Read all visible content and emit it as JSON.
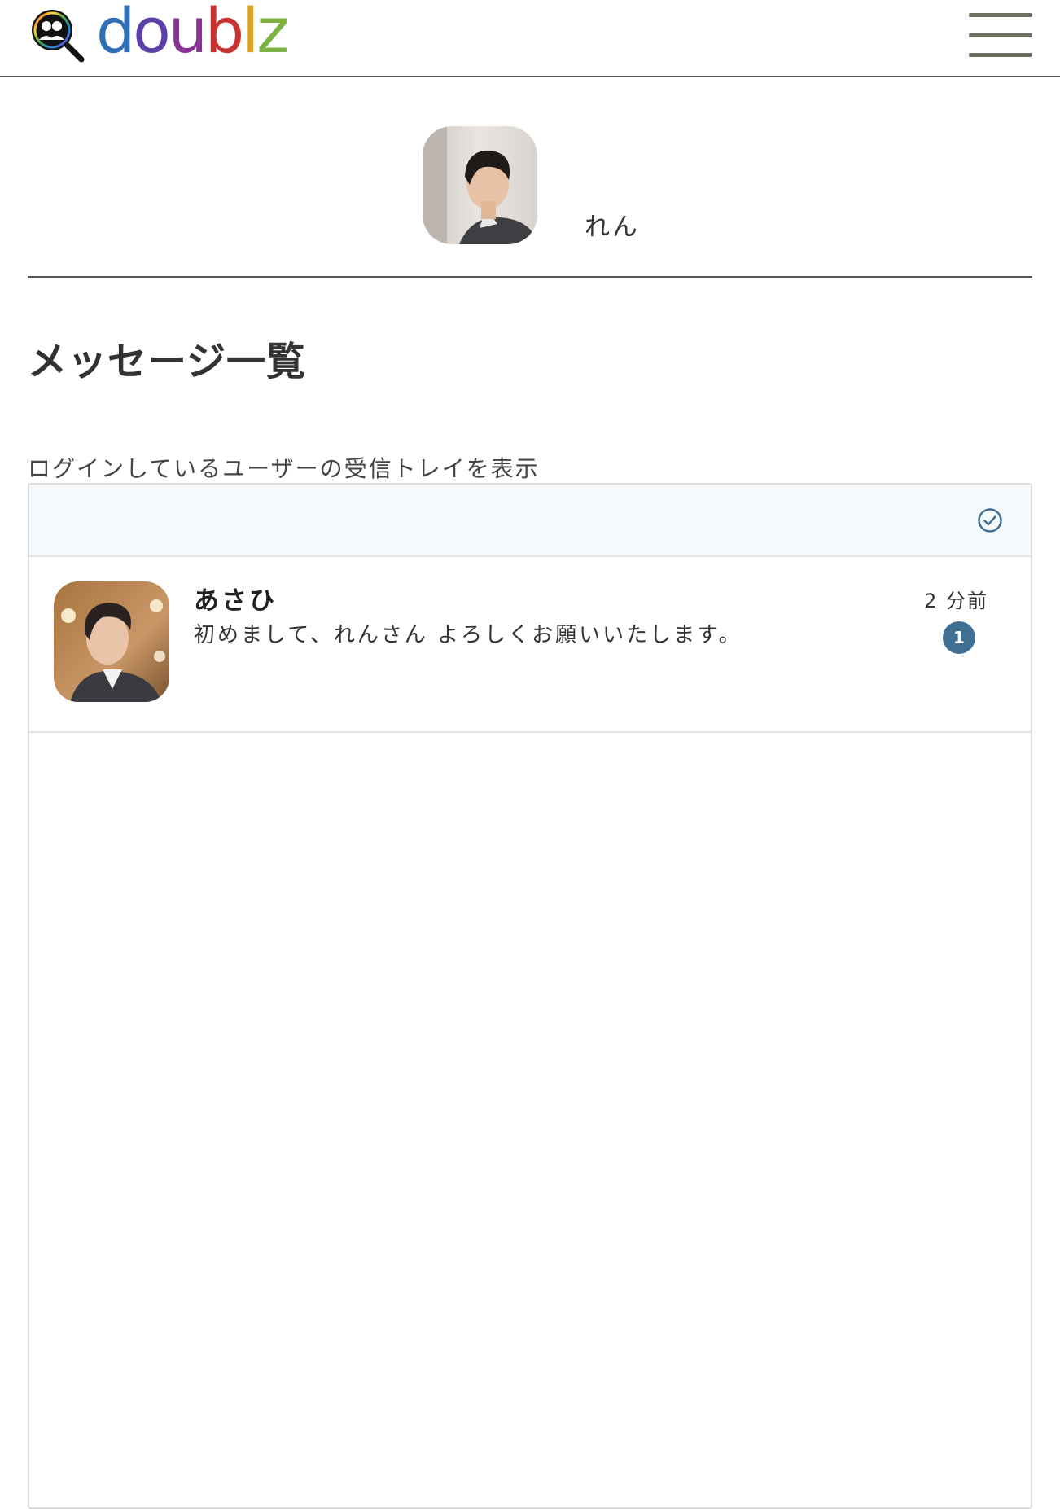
{
  "header": {
    "logo_letters": [
      "d",
      "o",
      "u",
      "b",
      "l",
      "z"
    ],
    "logo_colors": [
      "#2f6fb6",
      "#5b3fa8",
      "#8a3196",
      "#c8322f",
      "#e0a024",
      "#7cb342"
    ],
    "menu_icon": "hamburger-menu-icon",
    "menu_color": "#6b7262"
  },
  "profile": {
    "name": "れん"
  },
  "page": {
    "title": "メッセージ一覧",
    "caption": "ログインしているユーザーの受信トレイを表示"
  },
  "inbox": {
    "toolbar_icon": "check-circle-icon",
    "accent": "#3f6f93",
    "messages": [
      {
        "sender": "あさひ",
        "preview": "初めまして、れんさん よろしくお願いいたします。",
        "time": "2 分前",
        "unread": "1"
      }
    ]
  }
}
